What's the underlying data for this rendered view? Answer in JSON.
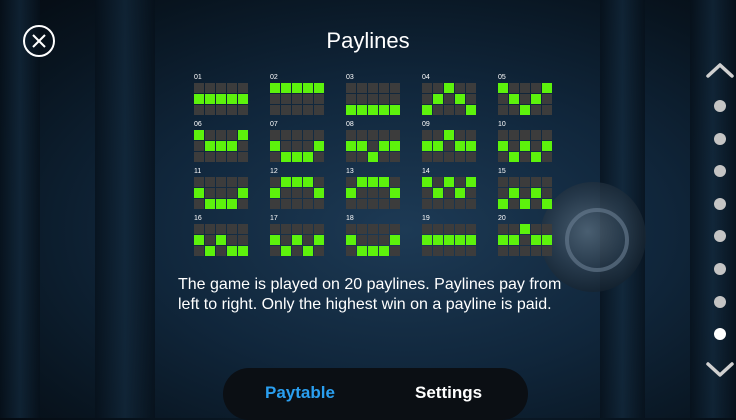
{
  "title": "Paylines",
  "description": "The game is played on 20 paylines. Paylines pay from left to right. Only the highest win on a payline is paid.",
  "paylines": [
    {
      "num": "01",
      "rows": [
        [
          0,
          0,
          0,
          0,
          0
        ],
        [
          1,
          1,
          1,
          1,
          1
        ],
        [
          0,
          0,
          0,
          0,
          0
        ]
      ]
    },
    {
      "num": "02",
      "rows": [
        [
          1,
          1,
          1,
          1,
          1
        ],
        [
          0,
          0,
          0,
          0,
          0
        ],
        [
          0,
          0,
          0,
          0,
          0
        ]
      ]
    },
    {
      "num": "03",
      "rows": [
        [
          0,
          0,
          0,
          0,
          0
        ],
        [
          0,
          0,
          0,
          0,
          0
        ],
        [
          1,
          1,
          1,
          1,
          1
        ]
      ]
    },
    {
      "num": "04",
      "rows": [
        [
          0,
          0,
          1,
          0,
          0
        ],
        [
          0,
          1,
          0,
          1,
          0
        ],
        [
          1,
          0,
          0,
          0,
          1
        ]
      ]
    },
    {
      "num": "05",
      "rows": [
        [
          1,
          0,
          0,
          0,
          1
        ],
        [
          0,
          1,
          0,
          1,
          0
        ],
        [
          0,
          0,
          1,
          0,
          0
        ]
      ]
    },
    {
      "num": "06",
      "rows": [
        [
          1,
          0,
          0,
          0,
          1
        ],
        [
          0,
          1,
          1,
          1,
          0
        ],
        [
          0,
          0,
          0,
          0,
          0
        ]
      ]
    },
    {
      "num": "07",
      "rows": [
        [
          0,
          0,
          0,
          0,
          0
        ],
        [
          1,
          0,
          0,
          0,
          1
        ],
        [
          0,
          1,
          1,
          1,
          0
        ]
      ]
    },
    {
      "num": "08",
      "rows": [
        [
          0,
          0,
          0,
          0,
          0
        ],
        [
          1,
          1,
          0,
          1,
          1
        ],
        [
          0,
          0,
          1,
          0,
          0
        ]
      ]
    },
    {
      "num": "09",
      "rows": [
        [
          0,
          0,
          1,
          0,
          0
        ],
        [
          1,
          1,
          0,
          1,
          1
        ],
        [
          0,
          0,
          0,
          0,
          0
        ]
      ]
    },
    {
      "num": "10",
      "rows": [
        [
          0,
          0,
          0,
          0,
          0
        ],
        [
          1,
          0,
          1,
          0,
          1
        ],
        [
          0,
          1,
          0,
          1,
          0
        ]
      ]
    },
    {
      "num": "11",
      "rows": [
        [
          0,
          0,
          0,
          0,
          0
        ],
        [
          1,
          0,
          0,
          0,
          1
        ],
        [
          0,
          1,
          1,
          1,
          0
        ]
      ]
    },
    {
      "num": "12",
      "rows": [
        [
          0,
          1,
          1,
          1,
          0
        ],
        [
          1,
          0,
          0,
          0,
          1
        ],
        [
          0,
          0,
          0,
          0,
          0
        ]
      ]
    },
    {
      "num": "13",
      "rows": [
        [
          0,
          1,
          1,
          1,
          0
        ],
        [
          1,
          0,
          0,
          0,
          1
        ],
        [
          0,
          0,
          0,
          0,
          0
        ]
      ]
    },
    {
      "num": "14",
      "rows": [
        [
          1,
          0,
          1,
          0,
          1
        ],
        [
          0,
          1,
          0,
          1,
          0
        ],
        [
          0,
          0,
          0,
          0,
          0
        ]
      ]
    },
    {
      "num": "15",
      "rows": [
        [
          0,
          0,
          0,
          0,
          0
        ],
        [
          0,
          1,
          0,
          1,
          0
        ],
        [
          1,
          0,
          1,
          0,
          1
        ]
      ]
    },
    {
      "num": "16",
      "rows": [
        [
          0,
          0,
          0,
          0,
          0
        ],
        [
          1,
          0,
          1,
          0,
          0
        ],
        [
          0,
          1,
          0,
          1,
          1
        ]
      ]
    },
    {
      "num": "17",
      "rows": [
        [
          0,
          0,
          0,
          0,
          0
        ],
        [
          1,
          0,
          1,
          0,
          1
        ],
        [
          0,
          1,
          0,
          1,
          0
        ]
      ]
    },
    {
      "num": "18",
      "rows": [
        [
          0,
          0,
          0,
          0,
          0
        ],
        [
          1,
          0,
          0,
          0,
          1
        ],
        [
          0,
          1,
          1,
          1,
          0
        ]
      ]
    },
    {
      "num": "19",
      "rows": [
        [
          0,
          0,
          0,
          0,
          0
        ],
        [
          1,
          1,
          1,
          1,
          1
        ],
        [
          0,
          0,
          0,
          0,
          0
        ]
      ]
    },
    {
      "num": "20",
      "rows": [
        [
          0,
          0,
          1,
          0,
          0
        ],
        [
          1,
          1,
          0,
          1,
          1
        ],
        [
          0,
          0,
          0,
          0,
          0
        ]
      ]
    }
  ],
  "pagination": {
    "total": 8,
    "active": 7
  },
  "tabs": {
    "paytable": "Paytable",
    "settings": "Settings"
  },
  "colors": {
    "active_cell": "#5df20c",
    "inactive_cell": "#3c3c3c",
    "active_tab": "#2a9ff0"
  },
  "icons": {
    "close": "close-icon",
    "up": "chevron-up-icon",
    "down": "chevron-down-icon"
  }
}
